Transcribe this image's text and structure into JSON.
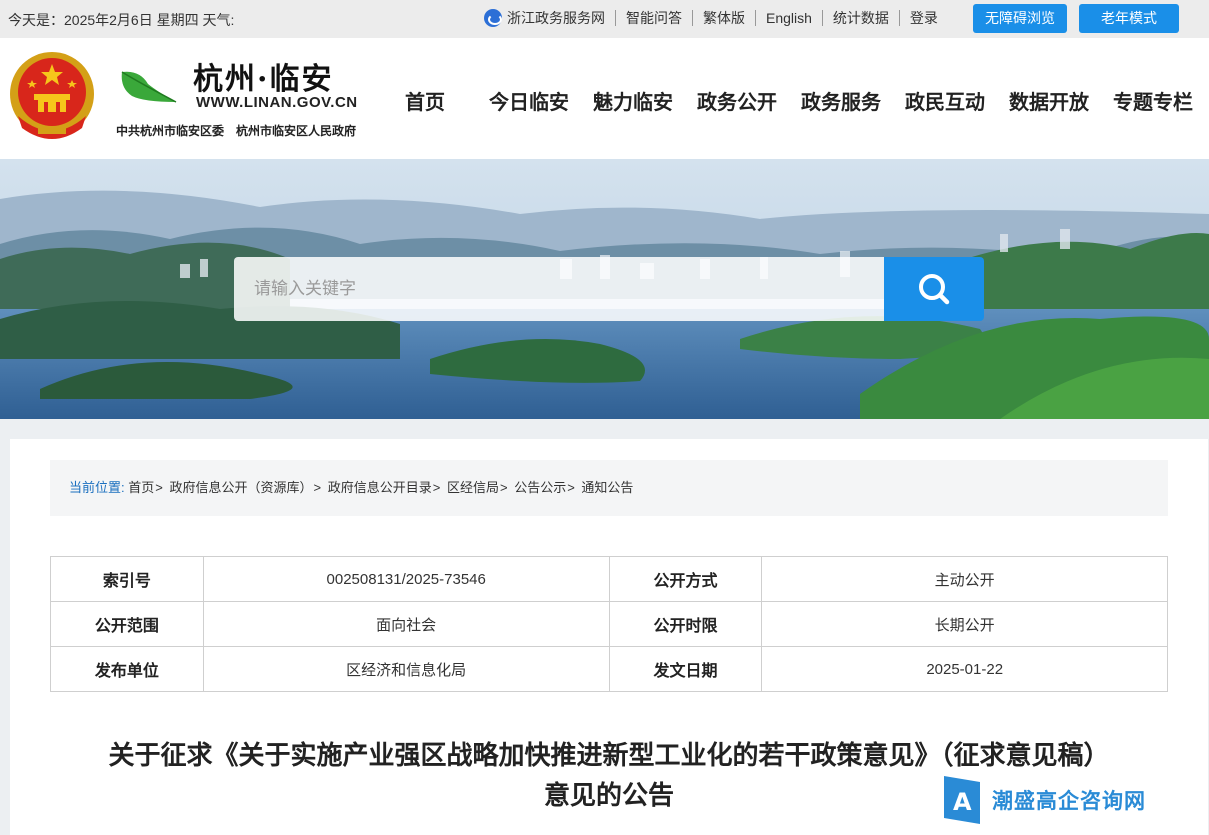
{
  "topbar": {
    "date_text": "今天是：2025年2月6日 星期四 天气:",
    "links": [
      {
        "label": "浙江政务服务网"
      },
      {
        "label": "智能问答"
      },
      {
        "label": "繁体版"
      },
      {
        "label": "English"
      },
      {
        "label": "统计数据"
      },
      {
        "label": "登录"
      }
    ],
    "accessibility_label": "无障碍浏览",
    "elder_mode_label": "老年模式"
  },
  "header": {
    "brand_title": "杭州·临安",
    "brand_url": "WWW.LINAN.GOV.CN",
    "brand_org": "中共杭州市临安区委　杭州市临安区人民政府",
    "nav": [
      {
        "label": "首页"
      },
      {
        "label": "今日临安"
      },
      {
        "label": "魅力临安"
      },
      {
        "label": "政务公开"
      },
      {
        "label": "政务服务"
      },
      {
        "label": "政民互动"
      },
      {
        "label": "数据开放"
      },
      {
        "label": "专题专栏"
      }
    ]
  },
  "search": {
    "placeholder": "请输入关键字"
  },
  "breadcrumb": {
    "label": "当前位置:",
    "items": [
      "首页",
      "政府信息公开（资源库）",
      "政府信息公开目录",
      "区经信局",
      "公告公示",
      "通知公告"
    ]
  },
  "meta_table": [
    {
      "k1": "索引号",
      "v1": "002508131/2025-73546",
      "k2": "公开方式",
      "v2": "主动公开"
    },
    {
      "k1": "公开范围",
      "v1": "面向社会",
      "k2": "公开时限",
      "v2": "长期公开"
    },
    {
      "k1": "发布单位",
      "v1": "区经济和信息化局",
      "k2": "发文日期",
      "v2": "2025-01-22"
    }
  ],
  "document": {
    "title_line1": "关于征求《关于实施产业强区战略加快推进新型工业化的若干政策意见》（征求意见稿）",
    "title_line2": "意见的公告"
  },
  "watermark": {
    "text": "潮盛高企咨询网"
  },
  "colors": {
    "accent_blue": "#1a8fe8",
    "breadcrumb_label": "#1a6fbf"
  }
}
